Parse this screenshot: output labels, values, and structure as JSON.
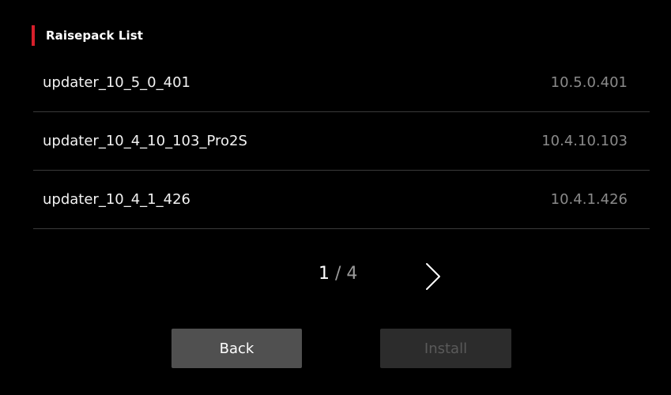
{
  "header": {
    "title": "Raisepack List",
    "accent_color": "#d71f2b"
  },
  "list": {
    "items": [
      {
        "name": "updater_10_5_0_401",
        "version": "10.5.0.401"
      },
      {
        "name": "updater_10_4_10_103_Pro2S",
        "version": "10.4.10.103"
      },
      {
        "name": "updater_10_4_1_426",
        "version": "10.4.1.426"
      }
    ]
  },
  "pagination": {
    "current": "1",
    "separator": "/",
    "total": "4",
    "next_icon": "chevron-right-icon"
  },
  "buttons": {
    "back_label": "Back",
    "install_label": "Install",
    "install_enabled": false
  }
}
